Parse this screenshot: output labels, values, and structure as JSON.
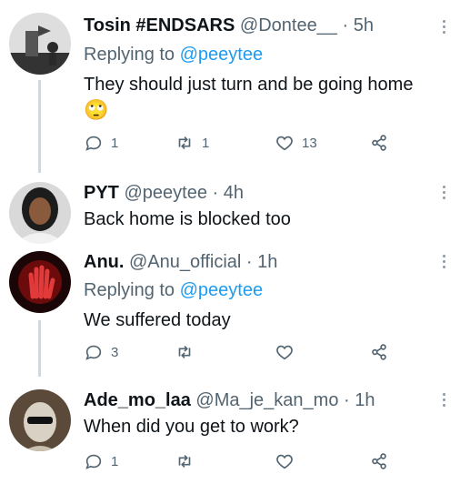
{
  "tweets": [
    {
      "name": "Tosin #ENDSARS",
      "handle": "@Dontee__",
      "time": "5h",
      "replying_label": "Replying to",
      "replying_handle": "@peeytee",
      "text": "They should just turn and be going home",
      "emoji": "🙄",
      "replies": "1",
      "retweets": "1",
      "likes": "13"
    },
    {
      "name": "PYT",
      "handle": "@peeytee",
      "time": "4h",
      "text": "Back home is blocked too"
    },
    {
      "name": "Anu.",
      "handle": "@Anu_official",
      "time": "1h",
      "replying_label": "Replying to",
      "replying_handle": "@peeytee",
      "text": "We suffered today",
      "replies": "3",
      "retweets": "",
      "likes": ""
    },
    {
      "name": "Ade_mo_laa",
      "handle": "@Ma_je_kan_mo",
      "time": "1h",
      "text": "When did you get to work?",
      "replies": "1",
      "retweets": "",
      "likes": ""
    }
  ],
  "separator": " · ",
  "colors": {
    "link": "#1d9bf0",
    "muted": "#536471",
    "text": "#0f1419",
    "line": "#cfd9de"
  },
  "icons": [
    "reply-icon",
    "retweet-icon",
    "like-icon",
    "share-icon",
    "more-icon"
  ]
}
